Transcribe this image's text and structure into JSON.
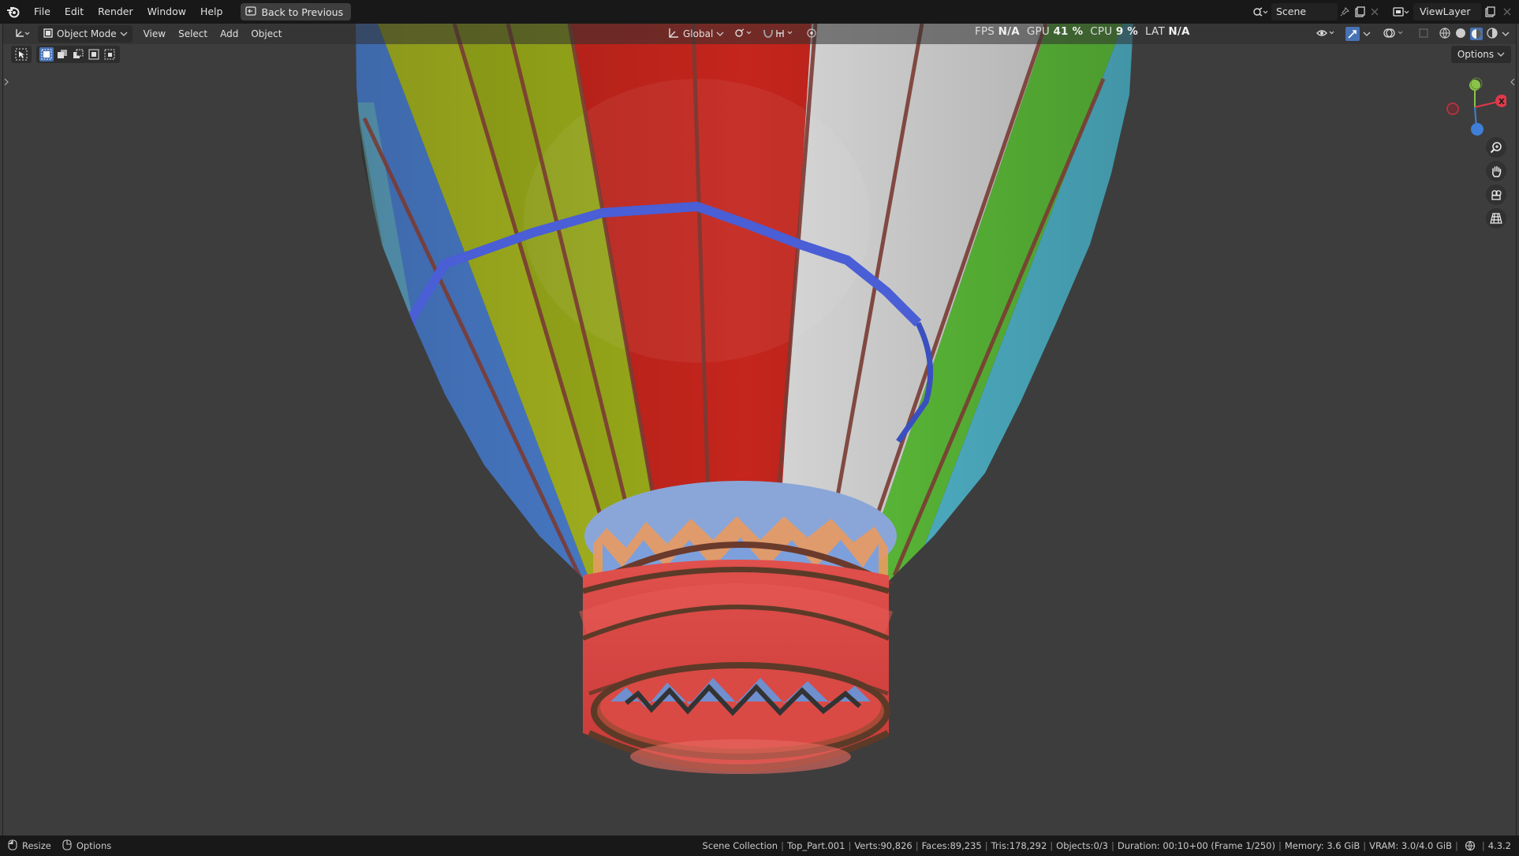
{
  "menubar": {
    "items": [
      "File",
      "Edit",
      "Render",
      "Window",
      "Help"
    ],
    "back_label": "Back to Previous",
    "scene_value": "Scene",
    "viewlayer_value": "ViewLayer"
  },
  "viewport_header": {
    "mode_label": "Object Mode",
    "menus": [
      "View",
      "Select",
      "Add",
      "Object"
    ],
    "orientation_label": "Global",
    "options_label": "Options"
  },
  "performance": {
    "fps_label": "FPS",
    "fps_value": "N/A",
    "gpu_label": "GPU",
    "gpu_value": "41 %",
    "cpu_label": "CPU",
    "cpu_value": "9 %",
    "lat_label": "LAT",
    "lat_value": "N/A"
  },
  "statusbar": {
    "resize_label": "Resize",
    "options_label": "Options",
    "collection": "Scene Collection",
    "object": "Top_Part.001",
    "verts": "Verts:90,826",
    "faces": "Faces:89,235",
    "tris": "Tris:178,292",
    "objects": "Objects:0/3",
    "duration": "Duration: 00:10+00 (Frame 1/250)",
    "memory": "Memory: 3.6 GiB",
    "vram": "VRAM: 3.0/4.0 GiB",
    "version": "4.3.2"
  },
  "colors": {
    "accent": "#4772b3",
    "axis_x": "#e0394a",
    "axis_y": "#8bc34a",
    "axis_z": "#3f7fd8"
  },
  "gizmo": {
    "x_label": "X"
  }
}
